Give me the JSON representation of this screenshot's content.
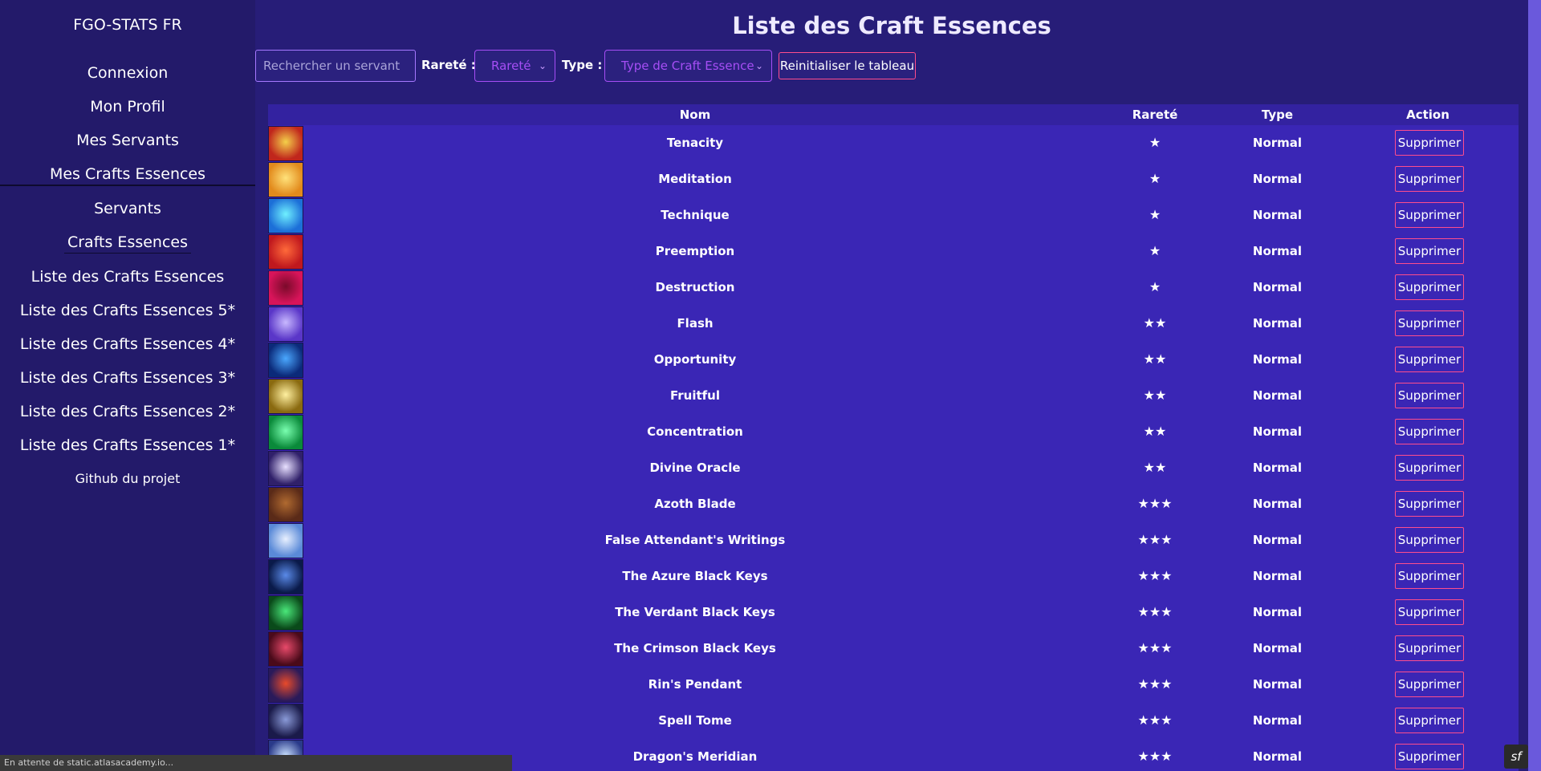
{
  "sidebar": {
    "brand": "FGO-STATS FR",
    "items": [
      {
        "label": "Connexion"
      },
      {
        "label": "Mon Profil"
      },
      {
        "label": "Mes Servants"
      },
      {
        "label": "Mes Crafts Essences"
      },
      {
        "label": "Servants"
      },
      {
        "label": "Crafts Essences"
      },
      {
        "label": "Liste des Crafts Essences"
      },
      {
        "label": "Liste des Crafts Essences 5*"
      },
      {
        "label": "Liste des Crafts Essences 4*"
      },
      {
        "label": "Liste des Crafts Essences 3*"
      },
      {
        "label": "Liste des Crafts Essences 2*"
      },
      {
        "label": "Liste des Crafts Essences 1*"
      },
      {
        "label": "Github du projet"
      }
    ]
  },
  "main": {
    "title": "Liste des Craft Essences",
    "filters": {
      "search_placeholder": "Rechercher un servant",
      "rarity_label": "Rareté :",
      "rarity_value": "Rareté",
      "type_label": "Type :",
      "type_value": "Type de Craft Essence",
      "reset_label": "Reinitialiser le tableau"
    },
    "table": {
      "headers": {
        "name": "Nom",
        "rarity": "Rareté",
        "type": "Type",
        "action": "Action"
      },
      "action_label": "Supprimer",
      "rows": [
        {
          "name": "Tenacity",
          "rarity": "★",
          "type": "Normal",
          "thumb_colors": [
            "#c0261c",
            "#f4d04a"
          ]
        },
        {
          "name": "Meditation",
          "rarity": "★",
          "type": "Normal",
          "thumb_colors": [
            "#e28a1c",
            "#ffe27a"
          ]
        },
        {
          "name": "Technique",
          "rarity": "★",
          "type": "Normal",
          "thumb_colors": [
            "#1c6fd8",
            "#6ff0ff"
          ]
        },
        {
          "name": "Preemption",
          "rarity": "★",
          "type": "Normal",
          "thumb_colors": [
            "#c0181e",
            "#ff6a3a"
          ]
        },
        {
          "name": "Destruction",
          "rarity": "★",
          "type": "Normal",
          "thumb_colors": [
            "#d8145a",
            "#7a0a2a"
          ]
        },
        {
          "name": "Flash",
          "rarity": "★★",
          "type": "Normal",
          "thumb_colors": [
            "#5a36c8",
            "#c8b8ff"
          ]
        },
        {
          "name": "Opportunity",
          "rarity": "★★",
          "type": "Normal",
          "thumb_colors": [
            "#0b2a7a",
            "#4aa8ff"
          ]
        },
        {
          "name": "Fruitful",
          "rarity": "★★",
          "type": "Normal",
          "thumb_colors": [
            "#8a6a10",
            "#fff0a0"
          ]
        },
        {
          "name": "Concentration",
          "rarity": "★★",
          "type": "Normal",
          "thumb_colors": [
            "#0a8a3a",
            "#7affb0"
          ]
        },
        {
          "name": "Divine Oracle",
          "rarity": "★★",
          "type": "Normal",
          "thumb_colors": [
            "#30206a",
            "#e8e0ff"
          ]
        },
        {
          "name": "Azoth Blade",
          "rarity": "★★★",
          "type": "Normal",
          "thumb_colors": [
            "#5a2a18",
            "#b06a30"
          ]
        },
        {
          "name": "False Attendant's Writings",
          "rarity": "★★★",
          "type": "Normal",
          "thumb_colors": [
            "#5a8ad8",
            "#e8f0ff"
          ]
        },
        {
          "name": "The Azure Black Keys",
          "rarity": "★★★",
          "type": "Normal",
          "thumb_colors": [
            "#0a1a4a",
            "#5a8ae8"
          ]
        },
        {
          "name": "The Verdant Black Keys",
          "rarity": "★★★",
          "type": "Normal",
          "thumb_colors": [
            "#0a4a1a",
            "#4ae87a"
          ]
        },
        {
          "name": "The Crimson Black Keys",
          "rarity": "★★★",
          "type": "Normal",
          "thumb_colors": [
            "#4a0a1a",
            "#e84a6a"
          ]
        },
        {
          "name": "Rin's Pendant",
          "rarity": "★★★",
          "type": "Normal",
          "thumb_colors": [
            "#2a1a5a",
            "#e84a2a"
          ]
        },
        {
          "name": "Spell Tome",
          "rarity": "★★★",
          "type": "Normal",
          "thumb_colors": [
            "#1a1a4a",
            "#8a9ad8"
          ]
        },
        {
          "name": "Dragon's Meridian",
          "rarity": "★★★",
          "type": "Normal",
          "thumb_colors": [
            "#2a3a8a",
            "#c8e0ff"
          ]
        }
      ]
    }
  },
  "status_bar": "En attente de static.atlasacademy.io...",
  "symfony_badge": "sf"
}
